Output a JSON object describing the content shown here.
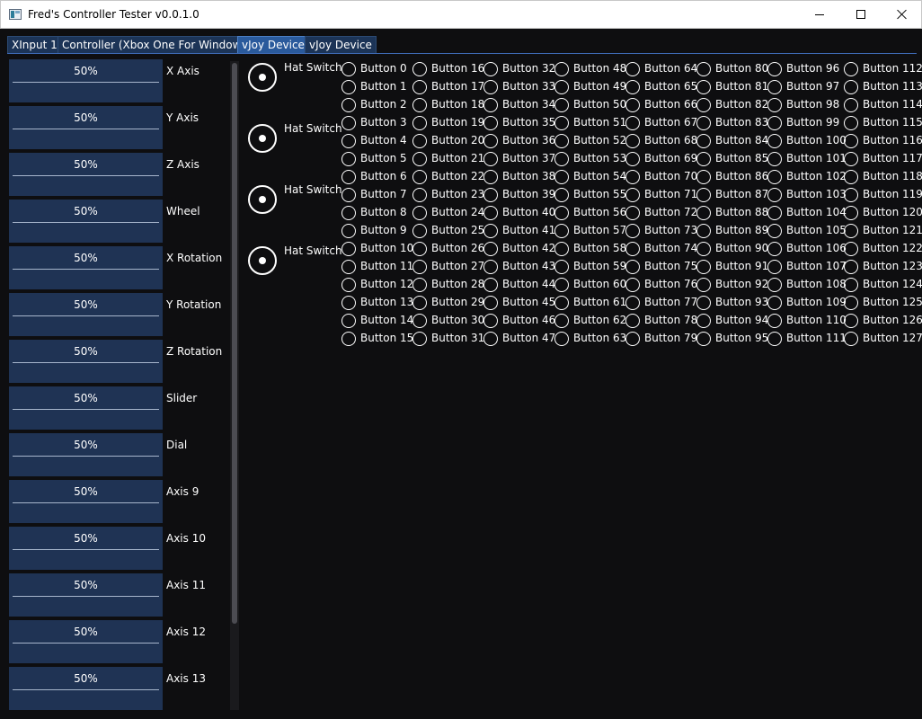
{
  "window": {
    "title": "Fred's Controller Tester v0.0.1.0",
    "controls": {
      "minimize": "minimize",
      "maximize": "maximize",
      "close": "close"
    }
  },
  "tabs": [
    {
      "label": "XInput 1",
      "active": false
    },
    {
      "label": "Controller (Xbox One For Windows)",
      "active": false
    },
    {
      "label": "vJoy Device",
      "active": true
    },
    {
      "label": "vJoy Device",
      "active": false
    }
  ],
  "axes": [
    {
      "label": "X Axis",
      "value": "50%"
    },
    {
      "label": "Y Axis",
      "value": "50%"
    },
    {
      "label": "Z Axis",
      "value": "50%"
    },
    {
      "label": "Wheel",
      "value": "50%"
    },
    {
      "label": "X Rotation",
      "value": "50%"
    },
    {
      "label": "Y Rotation",
      "value": "50%"
    },
    {
      "label": "Z Rotation",
      "value": "50%"
    },
    {
      "label": "Slider",
      "value": "50%"
    },
    {
      "label": "Dial",
      "value": "50%"
    },
    {
      "label": "Axis 9",
      "value": "50%"
    },
    {
      "label": "Axis 10",
      "value": "50%"
    },
    {
      "label": "Axis 11",
      "value": "50%"
    },
    {
      "label": "Axis 12",
      "value": "50%"
    },
    {
      "label": "Axis 13",
      "value": "50%"
    }
  ],
  "hat_switches": [
    {
      "label": "Hat Switch"
    },
    {
      "label": "Hat Switch"
    },
    {
      "label": "Hat Switch"
    },
    {
      "label": "Hat Switch"
    }
  ],
  "buttons": {
    "prefix": "Button",
    "count": 128
  },
  "colors": {
    "background": "#0e0e10",
    "axis_bar": "#1f3354",
    "tab": "#1c3457",
    "tab_active": "#2a5a9c",
    "accent_line": "#3e6bb5",
    "text": "#ffffff"
  }
}
